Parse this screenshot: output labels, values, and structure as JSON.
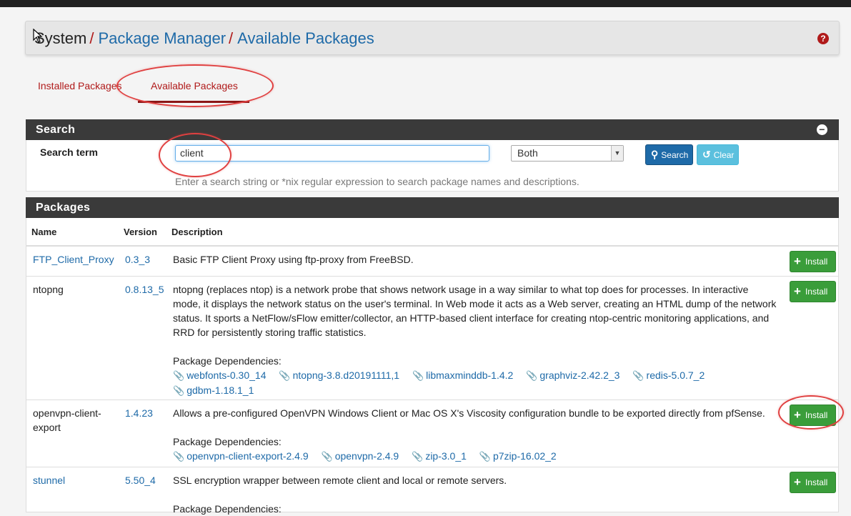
{
  "breadcrumb": {
    "root": "System",
    "separator": "/",
    "items": [
      "Package Manager",
      "Available Packages"
    ]
  },
  "help_icon": "question-circle-icon",
  "tabs": [
    {
      "label": "Installed Packages",
      "active": false
    },
    {
      "label": "Available Packages",
      "active": true
    }
  ],
  "search_panel": {
    "title": "Search",
    "term_label": "Search term",
    "term_value": "client",
    "scope_selected": "Both",
    "search_button": "Search",
    "clear_button": "Clear",
    "help_text": "Enter a search string or *nix regular expression to search package names and descriptions."
  },
  "packages_panel": {
    "title": "Packages",
    "columns": [
      "Name",
      "Version",
      "Description"
    ],
    "install_label": "Install",
    "dep_label": "Package Dependencies:",
    "rows": [
      {
        "name": "FTP_Client_Proxy",
        "version": "0.3_3",
        "description": "Basic FTP Client Proxy using ftp-proxy from FreeBSD.",
        "deps": []
      },
      {
        "name": "ntopng",
        "version": "0.8.13_5",
        "description": "ntopng (replaces ntop) is a network probe that shows network usage in a way similar to what top does for processes. In interactive mode, it displays the network status on the user's terminal. In Web mode it acts as a Web server, creating an HTML dump of the network status. It sports a NetFlow/sFlow emitter/collector, an HTTP-based client interface for creating ntop-centric monitoring applications, and RRD for persistently storing traffic statistics.",
        "deps": [
          "webfonts-0.30_14",
          "ntopng-3.8.d20191111,1",
          "libmaxminddb-1.4.2",
          "graphviz-2.42.2_3",
          "redis-5.0.7_2",
          "gdbm-1.18.1_1"
        ]
      },
      {
        "name": "openvpn-client-export",
        "version": "1.4.23",
        "description": "Allows a pre-configured OpenVPN Windows Client or Mac OS X's Viscosity configuration bundle to be exported directly from pfSense.",
        "deps": [
          "openvpn-client-export-2.4.9",
          "openvpn-2.4.9",
          "zip-3.0_1",
          "p7zip-16.02_2"
        ]
      },
      {
        "name": "stunnel",
        "version": "5.50_4",
        "description": "SSL encryption wrapper between remote client and local or remote servers.",
        "deps": []
      }
    ]
  },
  "colors": {
    "accent_red": "#b01a1a",
    "link_blue": "#1e6aa8",
    "install_green": "#3a9d3a",
    "panel_heading": "#3a3a3a",
    "annotation": "#e04040"
  }
}
